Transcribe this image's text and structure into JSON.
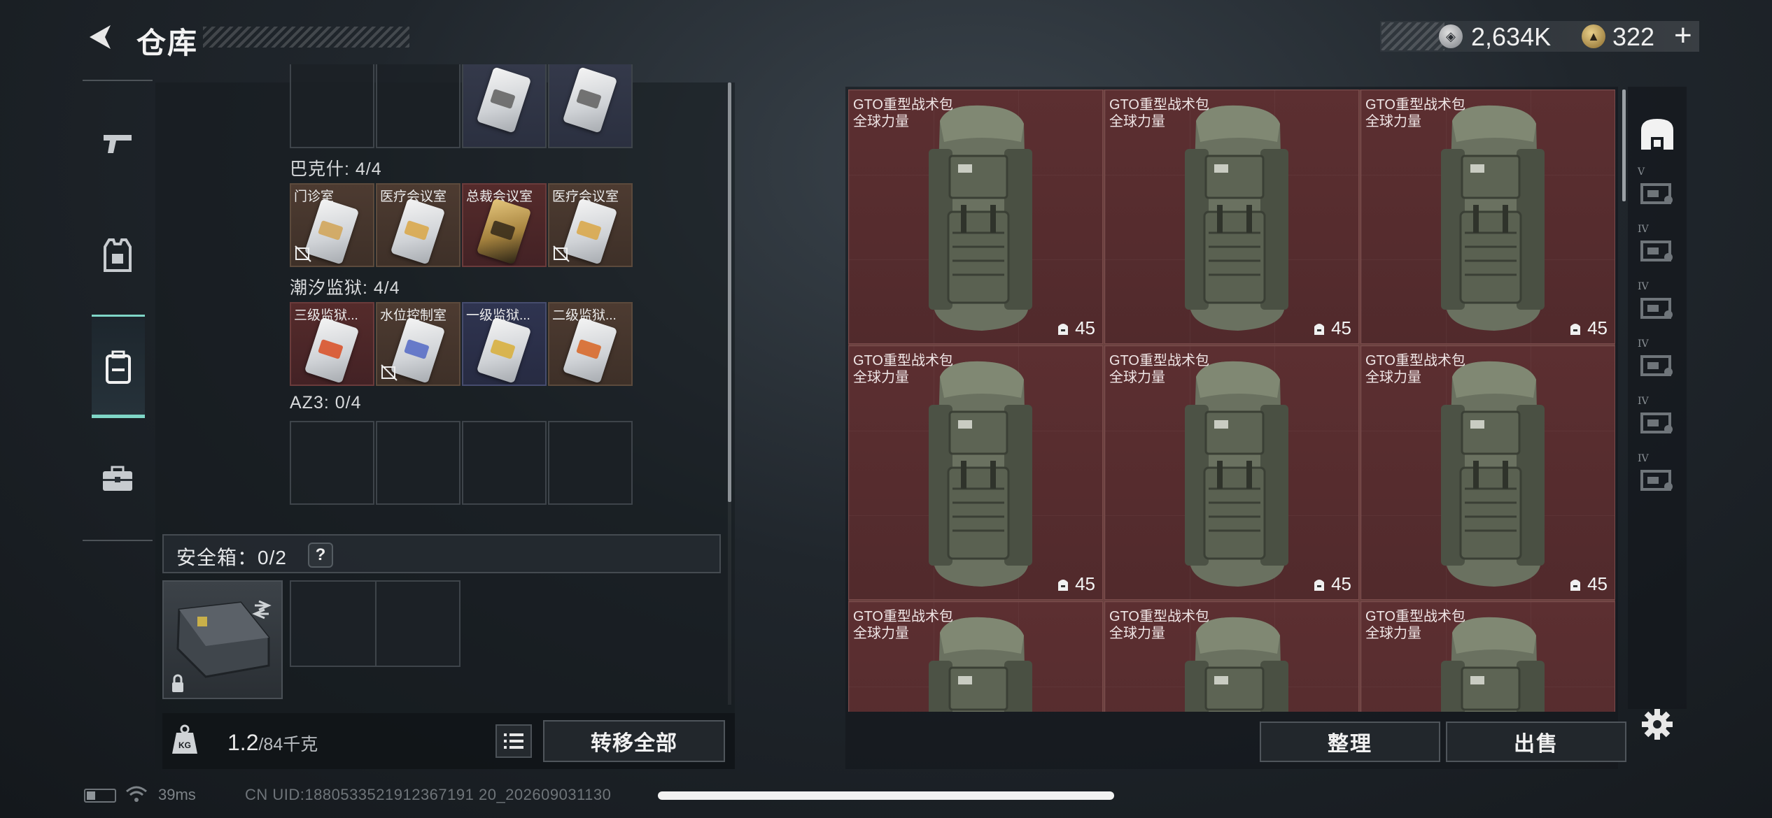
{
  "header": {
    "title": "仓库",
    "back_icon": "back-arrow-icon",
    "currencies": [
      {
        "name": "silver-coin",
        "value": "2,634K"
      },
      {
        "name": "gold-coin",
        "value": "322"
      }
    ],
    "add_label": "+"
  },
  "left_nav": {
    "items": [
      {
        "icon": "pistol-icon",
        "active": false
      },
      {
        "icon": "vest-icon",
        "active": false
      },
      {
        "icon": "backpack-icon",
        "active": true
      },
      {
        "icon": "briefcase-icon",
        "active": false
      }
    ]
  },
  "keycard_sections": [
    {
      "title": "",
      "slots": [
        {
          "label": "",
          "tint": "empty"
        },
        {
          "label": "",
          "tint": "empty"
        },
        {
          "label": "",
          "tint": "blue",
          "card": true
        },
        {
          "label": "",
          "tint": "blue",
          "card": true
        }
      ]
    },
    {
      "title": "巴克什: 4/4",
      "slots": [
        {
          "label": "门诊室",
          "tint": "brown",
          "locked": true
        },
        {
          "label": "医疗会议室",
          "tint": "brown",
          "locked": false
        },
        {
          "label": "总裁会议室",
          "tint": "red",
          "locked": false,
          "gold": true
        },
        {
          "label": "医疗会议室",
          "tint": "brown",
          "locked": true
        }
      ]
    },
    {
      "title": "潮汐监狱: 4/4",
      "slots": [
        {
          "label": "三级监狱...",
          "tint": "red",
          "locked": false
        },
        {
          "label": "水位控制室",
          "tint": "brown",
          "locked": true
        },
        {
          "label": "一级监狱...",
          "tint": "blue",
          "locked": false
        },
        {
          "label": "二级监狱...",
          "tint": "brown",
          "locked": false
        }
      ]
    },
    {
      "title": "AZ3: 0/4",
      "slots": [
        {
          "label": "",
          "tint": "empty"
        },
        {
          "label": "",
          "tint": "empty"
        },
        {
          "label": "",
          "tint": "empty"
        },
        {
          "label": "",
          "tint": "empty"
        }
      ]
    }
  ],
  "safe_box": {
    "label": "安全箱：0/2",
    "help": "?"
  },
  "weight": {
    "current": "1.2",
    "max_unit": "/84千克"
  },
  "buttons": {
    "transfer_all": "转移全部",
    "sort": "整理",
    "sell": "出售"
  },
  "stash_items": [
    {
      "name": "GTO重型战术包",
      "sub": "全球力量",
      "count": "45"
    },
    {
      "name": "GTO重型战术包",
      "sub": "全球力量",
      "count": "45"
    },
    {
      "name": "GTO重型战术包",
      "sub": "全球力量",
      "count": "45"
    },
    {
      "name": "GTO重型战术包",
      "sub": "全球力量",
      "count": "45"
    },
    {
      "name": "GTO重型战术包",
      "sub": "全球力量",
      "count": "45"
    },
    {
      "name": "GTO重型战术包",
      "sub": "全球力量",
      "count": "45"
    },
    {
      "name": "GTO重型战术包",
      "sub": "全球力量",
      "count": ""
    },
    {
      "name": "GTO重型战术包",
      "sub": "全球力量",
      "count": ""
    },
    {
      "name": "GTO重型战术包",
      "sub": "全球力量",
      "count": ""
    }
  ],
  "right_tabs": [
    {
      "icon": "stash-home-icon",
      "label": "",
      "active": true
    },
    {
      "icon": "stash-v-icon",
      "label": "V",
      "active": false
    },
    {
      "icon": "stash-iv-a-icon",
      "label": "IV",
      "active": false
    },
    {
      "icon": "stash-iv-b-icon",
      "label": "IV",
      "active": false
    },
    {
      "icon": "stash-iv-c-icon",
      "label": "IV",
      "active": false
    },
    {
      "icon": "stash-iv-d-icon",
      "label": "IV",
      "active": false
    },
    {
      "icon": "stash-iv-e-icon",
      "label": "IV",
      "active": false
    }
  ],
  "status": {
    "ping": "39ms",
    "uid": "CN UID:1880533521912367191 20_202609031130"
  },
  "colors": {
    "accent": "#7fd6c7",
    "item_red": "#552b2b"
  }
}
